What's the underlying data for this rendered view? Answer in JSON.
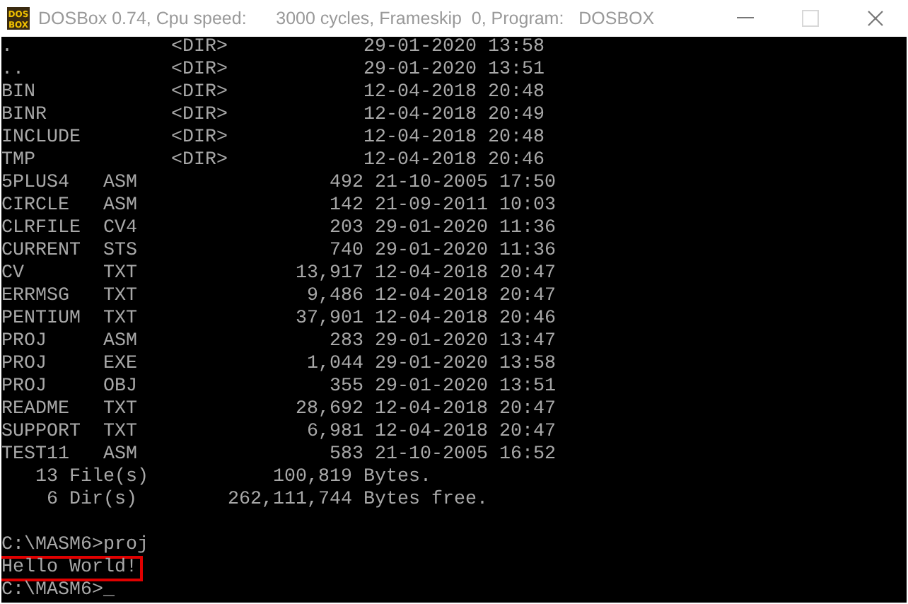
{
  "window": {
    "title": "DOSBox 0.74, Cpu speed:      3000 cycles, Frameskip  0, Program:   DOSBOX",
    "icon_text": [
      "DOS",
      "BOX"
    ],
    "controls": [
      {
        "kind": "minimize",
        "disabled": false
      },
      {
        "kind": "maximize",
        "disabled": true
      },
      {
        "kind": "close",
        "disabled": false
      }
    ]
  },
  "listing": [
    {
      "kind": "dir",
      "name": ".",
      "tag": "<DIR>",
      "date": "29-01-2020",
      "time": "13:58"
    },
    {
      "kind": "dir",
      "name": "..",
      "tag": "<DIR>",
      "date": "29-01-2020",
      "time": "13:51"
    },
    {
      "kind": "dir",
      "name": "BIN",
      "tag": "<DIR>",
      "date": "12-04-2018",
      "time": "20:48"
    },
    {
      "kind": "dir",
      "name": "BINR",
      "tag": "<DIR>",
      "date": "12-04-2018",
      "time": "20:49"
    },
    {
      "kind": "dir",
      "name": "INCLUDE",
      "tag": "<DIR>",
      "date": "12-04-2018",
      "time": "20:48"
    },
    {
      "kind": "dir",
      "name": "TMP",
      "tag": "<DIR>",
      "date": "12-04-2018",
      "time": "20:46"
    },
    {
      "kind": "file",
      "name": "5PLUS4",
      "ext": "ASM",
      "size": "492",
      "date": "21-10-2005",
      "time": "17:50"
    },
    {
      "kind": "file",
      "name": "CIRCLE",
      "ext": "ASM",
      "size": "142",
      "date": "21-09-2011",
      "time": "10:03"
    },
    {
      "kind": "file",
      "name": "CLRFILE",
      "ext": "CV4",
      "size": "203",
      "date": "29-01-2020",
      "time": "11:36"
    },
    {
      "kind": "file",
      "name": "CURRENT",
      "ext": "STS",
      "size": "740",
      "date": "29-01-2020",
      "time": "11:36"
    },
    {
      "kind": "file",
      "name": "CV",
      "ext": "TXT",
      "size": "13,917",
      "date": "12-04-2018",
      "time": "20:47"
    },
    {
      "kind": "file",
      "name": "ERRMSG",
      "ext": "TXT",
      "size": "9,486",
      "date": "12-04-2018",
      "time": "20:47"
    },
    {
      "kind": "file",
      "name": "PENTIUM",
      "ext": "TXT",
      "size": "37,901",
      "date": "12-04-2018",
      "time": "20:46"
    },
    {
      "kind": "file",
      "name": "PROJ",
      "ext": "ASM",
      "size": "283",
      "date": "29-01-2020",
      "time": "13:47"
    },
    {
      "kind": "file",
      "name": "PROJ",
      "ext": "EXE",
      "size": "1,044",
      "date": "29-01-2020",
      "time": "13:58"
    },
    {
      "kind": "file",
      "name": "PROJ",
      "ext": "OBJ",
      "size": "355",
      "date": "29-01-2020",
      "time": "13:51"
    },
    {
      "kind": "file",
      "name": "README",
      "ext": "TXT",
      "size": "28,692",
      "date": "12-04-2018",
      "time": "20:47"
    },
    {
      "kind": "file",
      "name": "SUPPORT",
      "ext": "TXT",
      "size": "6,981",
      "date": "12-04-2018",
      "time": "20:47"
    },
    {
      "kind": "file",
      "name": "TEST11",
      "ext": "ASM",
      "size": "583",
      "date": "21-10-2005",
      "time": "16:52"
    }
  ],
  "summary": [
    {
      "count": "13",
      "label": "File(s)",
      "bytes": "100,819",
      "suffix": "Bytes."
    },
    {
      "count": "6",
      "label": "Dir(s)",
      "bytes": "262,111,744",
      "suffix": "Bytes free."
    }
  ],
  "console_lines": [
    {
      "kind": "blank"
    },
    {
      "kind": "text",
      "text": "C:\\MASM6>proj",
      "highlighted": false
    },
    {
      "kind": "text",
      "text": "Hello World!",
      "highlighted": true
    },
    {
      "kind": "text",
      "text": "C:\\MASM6>_",
      "highlighted": false
    }
  ]
}
